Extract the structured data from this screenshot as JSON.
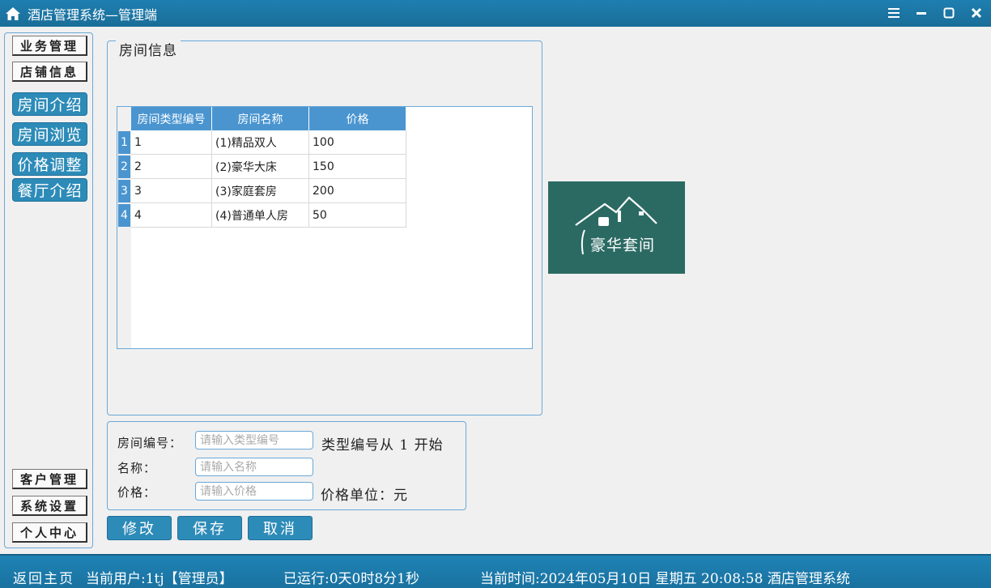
{
  "window": {
    "title": "酒店管理系统—管理端",
    "icons": [
      "home-icon",
      "menu-icon",
      "minimize-icon",
      "maximize-icon",
      "close-icon"
    ],
    "accent": "#1e7fb0"
  },
  "leftnav": {
    "top_items": [
      "业务管理",
      "店铺信息"
    ],
    "sub_items": [
      "房间介绍",
      "房间浏览",
      "价格调整",
      "餐厅介绍"
    ],
    "bottom_items": [
      "客户管理",
      "系统设置",
      "个人中心"
    ]
  },
  "room_info": {
    "group_title": "房间信息",
    "columns": [
      "房间类型编号",
      "房间名称",
      "价格"
    ],
    "row_numbers": [
      "1",
      "2",
      "3",
      "4"
    ],
    "rows": [
      [
        "1",
        "(1)精品双人",
        "100"
      ],
      [
        "2",
        "(2)豪华大床",
        "150"
      ],
      [
        "3",
        "(3)家庭套房",
        "200"
      ],
      [
        "4",
        "(4)普通单人房",
        "50"
      ]
    ],
    "header_color": "#4a95d0"
  },
  "room_image": {
    "label": "豪华套间",
    "background": "#2b6a63"
  },
  "form": {
    "room_number_label": "房间编号：",
    "room_number_placeholder": "请输入类型编号",
    "room_number_note": "类型编号从 1 开始",
    "name_label": "名称：",
    "name_placeholder": "请输入名称",
    "price_label": "价格：",
    "price_placeholder": "请输入价格",
    "price_note": "价格单位：元"
  },
  "actions": {
    "modify": "修改",
    "save": "保存",
    "cancel": "取消"
  },
  "status": {
    "home": "返回主页",
    "current_user": "当前用户:1tj【管理员】",
    "uptime": "已运行:0天0时8分1秒",
    "current_time": "当前时间:2024年05月10日 星期五 20:08:58 酒店管理系统"
  }
}
